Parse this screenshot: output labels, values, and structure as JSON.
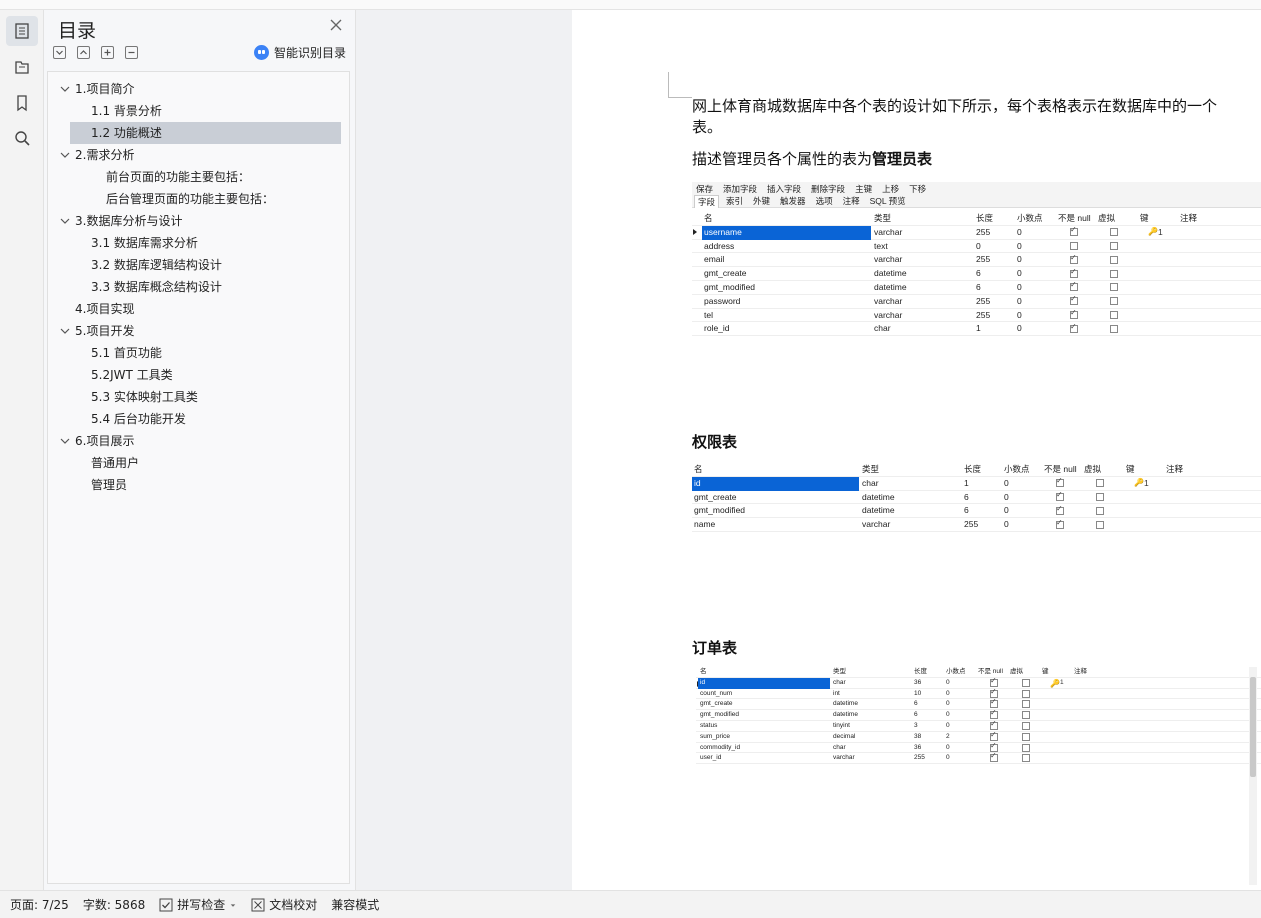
{
  "toc": {
    "title": "目录",
    "smart_label": "智能识别目录",
    "items": [
      {
        "text": "1.项目简介",
        "level": 1,
        "expanded": true,
        "selected": false
      },
      {
        "text": "1.1 背景分析",
        "level": 2,
        "expanded": null,
        "selected": false
      },
      {
        "text": "1.2 功能概述",
        "level": 2,
        "expanded": null,
        "selected": true
      },
      {
        "text": "2.需求分析",
        "level": 1,
        "expanded": true,
        "selected": false
      },
      {
        "text": "前台页面的功能主要包括：",
        "level": 3,
        "expanded": null,
        "selected": false
      },
      {
        "text": "后台管理页面的功能主要包括：",
        "level": 3,
        "expanded": null,
        "selected": false
      },
      {
        "text": "3.数据库分析与设计",
        "level": 1,
        "expanded": true,
        "selected": false
      },
      {
        "text": "3.1 数据库需求分析",
        "level": 2,
        "expanded": null,
        "selected": false
      },
      {
        "text": "3.2 数据库逻辑结构设计",
        "level": 2,
        "expanded": null,
        "selected": false
      },
      {
        "text": "3.3 数据库概念结构设计",
        "level": 2,
        "expanded": null,
        "selected": false
      },
      {
        "text": "4.项目实现",
        "level": 1,
        "expanded": null,
        "selected": false
      },
      {
        "text": "5.项目开发",
        "level": 1,
        "expanded": true,
        "selected": false
      },
      {
        "text": "5.1 首页功能",
        "level": 2,
        "expanded": null,
        "selected": false
      },
      {
        "text": "5.2JWT 工具类",
        "level": 2,
        "expanded": null,
        "selected": false
      },
      {
        "text": "5.3 实体映射工具类",
        "level": 2,
        "expanded": null,
        "selected": false
      },
      {
        "text": "5.4 后台功能开发",
        "level": 2,
        "expanded": null,
        "selected": false
      },
      {
        "text": "6.项目展示",
        "level": 1,
        "expanded": true,
        "selected": false
      },
      {
        "text": "普通用户",
        "level": 2,
        "expanded": null,
        "selected": false
      },
      {
        "text": "管理员",
        "level": 2,
        "expanded": null,
        "selected": false
      }
    ]
  },
  "doc": {
    "intro_line1": "网上体育商城数据库中各个表的设计如下所示，每个表格表示在数据库中的一个",
    "intro_line2": "表。",
    "admin_desc_prefix": "描述管理员各个属性的表为",
    "admin_desc_bold": "管理员表",
    "perm_heading": "权限表",
    "order_heading": "订单表"
  },
  "admin_table": {
    "toolbar": [
      "保存",
      "添加字段",
      "插入字段",
      "删除字段",
      "主键",
      "上移",
      "下移"
    ],
    "tabs": [
      "字段",
      "索引",
      "外键",
      "触发器",
      "选项",
      "注释",
      "SQL 预览"
    ],
    "headers": [
      "名",
      "类型",
      "长度",
      "小数点",
      "不是 null",
      "虚拟",
      "键",
      "注释"
    ],
    "rows": [
      {
        "name": "username",
        "type": "varchar",
        "len": "255",
        "dec": "0",
        "notnull": true,
        "virtual": false,
        "key": "1",
        "selected": true
      },
      {
        "name": "address",
        "type": "text",
        "len": "0",
        "dec": "0",
        "notnull": false,
        "virtual": false,
        "key": "",
        "selected": false
      },
      {
        "name": "email",
        "type": "varchar",
        "len": "255",
        "dec": "0",
        "notnull": true,
        "virtual": false,
        "key": "",
        "selected": false
      },
      {
        "name": "gmt_create",
        "type": "datetime",
        "len": "6",
        "dec": "0",
        "notnull": true,
        "virtual": false,
        "key": "",
        "selected": false
      },
      {
        "name": "gmt_modified",
        "type": "datetime",
        "len": "6",
        "dec": "0",
        "notnull": true,
        "virtual": false,
        "key": "",
        "selected": false
      },
      {
        "name": "password",
        "type": "varchar",
        "len": "255",
        "dec": "0",
        "notnull": true,
        "virtual": false,
        "key": "",
        "selected": false
      },
      {
        "name": "tel",
        "type": "varchar",
        "len": "255",
        "dec": "0",
        "notnull": true,
        "virtual": false,
        "key": "",
        "selected": false
      },
      {
        "name": "role_id",
        "type": "char",
        "len": "1",
        "dec": "0",
        "notnull": true,
        "virtual": false,
        "key": "",
        "selected": false
      }
    ]
  },
  "perm_table": {
    "headers": [
      "名",
      "类型",
      "长度",
      "小数点",
      "不是 null",
      "虚拟",
      "键",
      "注释"
    ],
    "rows": [
      {
        "name": "id",
        "type": "char",
        "len": "1",
        "dec": "0",
        "notnull": true,
        "virtual": false,
        "key": "1",
        "selected": true
      },
      {
        "name": "gmt_create",
        "type": "datetime",
        "len": "6",
        "dec": "0",
        "notnull": true,
        "virtual": false,
        "key": "",
        "selected": false
      },
      {
        "name": "gmt_modified",
        "type": "datetime",
        "len": "6",
        "dec": "0",
        "notnull": true,
        "virtual": false,
        "key": "",
        "selected": false
      },
      {
        "name": "name",
        "type": "varchar",
        "len": "255",
        "dec": "0",
        "notnull": true,
        "virtual": false,
        "key": "",
        "selected": false
      }
    ]
  },
  "order_table": {
    "headers": [
      "名",
      "类型",
      "长度",
      "小数点",
      "不是 null",
      "虚拟",
      "键",
      "注释"
    ],
    "rows": [
      {
        "name": "id",
        "type": "char",
        "len": "36",
        "dec": "0",
        "notnull": true,
        "virtual": false,
        "key": "1",
        "selected": true
      },
      {
        "name": "count_num",
        "type": "int",
        "len": "10",
        "dec": "0",
        "notnull": true,
        "virtual": false,
        "key": "",
        "selected": false
      },
      {
        "name": "gmt_create",
        "type": "datetime",
        "len": "6",
        "dec": "0",
        "notnull": true,
        "virtual": false,
        "key": "",
        "selected": false
      },
      {
        "name": "gmt_modified",
        "type": "datetime",
        "len": "6",
        "dec": "0",
        "notnull": true,
        "virtual": false,
        "key": "",
        "selected": false
      },
      {
        "name": "status",
        "type": "tinyint",
        "len": "3",
        "dec": "0",
        "notnull": true,
        "virtual": false,
        "key": "",
        "selected": false
      },
      {
        "name": "sum_price",
        "type": "decimal",
        "len": "38",
        "dec": "2",
        "notnull": true,
        "virtual": false,
        "key": "",
        "selected": false
      },
      {
        "name": "commodity_id",
        "type": "char",
        "len": "36",
        "dec": "0",
        "notnull": true,
        "virtual": false,
        "key": "",
        "selected": false
      },
      {
        "name": "user_id",
        "type": "varchar",
        "len": "255",
        "dec": "0",
        "notnull": true,
        "virtual": false,
        "key": "",
        "selected": false
      }
    ]
  },
  "status": {
    "page": "页面: 7/25",
    "words": "字数: 5868",
    "spell": "拼写检查",
    "proof": "文档校对",
    "compat": "兼容模式"
  },
  "colors": {
    "selection": "#0a64d6",
    "toc_selected": "#c9ced6",
    "smart_icon": "#3b82f6"
  }
}
